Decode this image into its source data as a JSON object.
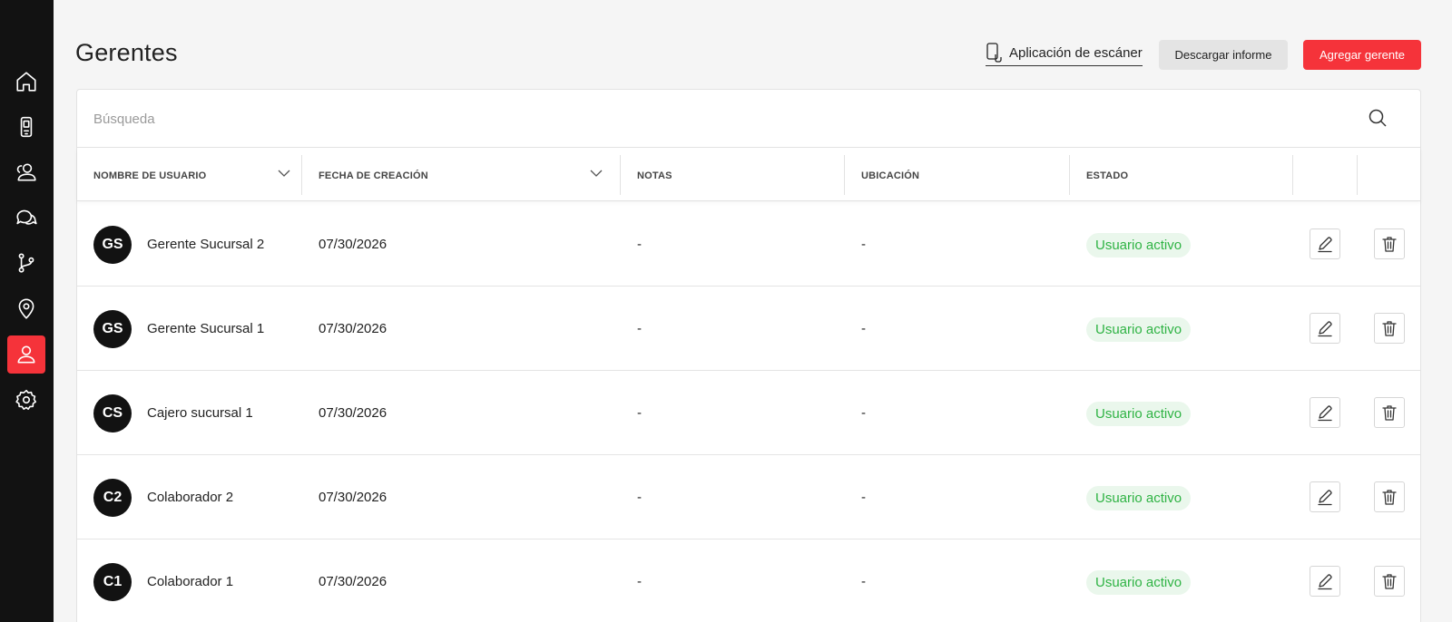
{
  "sidebar": {
    "items": [
      {
        "icon": "home-icon",
        "active": false
      },
      {
        "icon": "mobile-scanner-icon",
        "active": false
      },
      {
        "icon": "users-icon",
        "active": false
      },
      {
        "icon": "chat-icon",
        "active": false
      },
      {
        "icon": "branch-icon",
        "active": false
      },
      {
        "icon": "location-pin-icon",
        "active": false
      },
      {
        "icon": "user-icon",
        "active": true
      },
      {
        "icon": "settings-gear-icon",
        "active": false
      }
    ],
    "active_color": "#f5333a"
  },
  "header": {
    "title": "Gerentes",
    "scanner_link": "Aplicación de escáner",
    "download_button": "Descargar informe",
    "add_button": "Agregar gerente"
  },
  "search": {
    "placeholder": "Búsqueda",
    "value": ""
  },
  "table": {
    "columns": {
      "username": "NOMBRE DE USUARIO",
      "created": "FECHA DE CREACIÓN",
      "notes": "NOTAS",
      "location": "UBICACIÓN",
      "status": "ESTADO"
    },
    "rows": [
      {
        "initials": "GS",
        "name": "Gerente Sucursal 2",
        "date": "07/30/2026",
        "notes": "-",
        "location": "-",
        "status": "Usuario activo"
      },
      {
        "initials": "GS",
        "name": "Gerente Sucursal 1",
        "date": "07/30/2026",
        "notes": "-",
        "location": "-",
        "status": "Usuario activo"
      },
      {
        "initials": "CS",
        "name": "Cajero sucursal 1",
        "date": "07/30/2026",
        "notes": "-",
        "location": "-",
        "status": "Usuario activo"
      },
      {
        "initials": "C2",
        "name": "Colaborador 2",
        "date": "07/30/2026",
        "notes": "-",
        "location": "-",
        "status": "Usuario activo"
      },
      {
        "initials": "C1",
        "name": "Colaborador 1",
        "date": "07/30/2026",
        "notes": "-",
        "location": "-",
        "status": "Usuario activo"
      }
    ]
  },
  "colors": {
    "accent": "#f5333a",
    "sidebar_bg": "#121212",
    "status_text": "#2fb344",
    "status_bg": "#eaf7ec"
  }
}
